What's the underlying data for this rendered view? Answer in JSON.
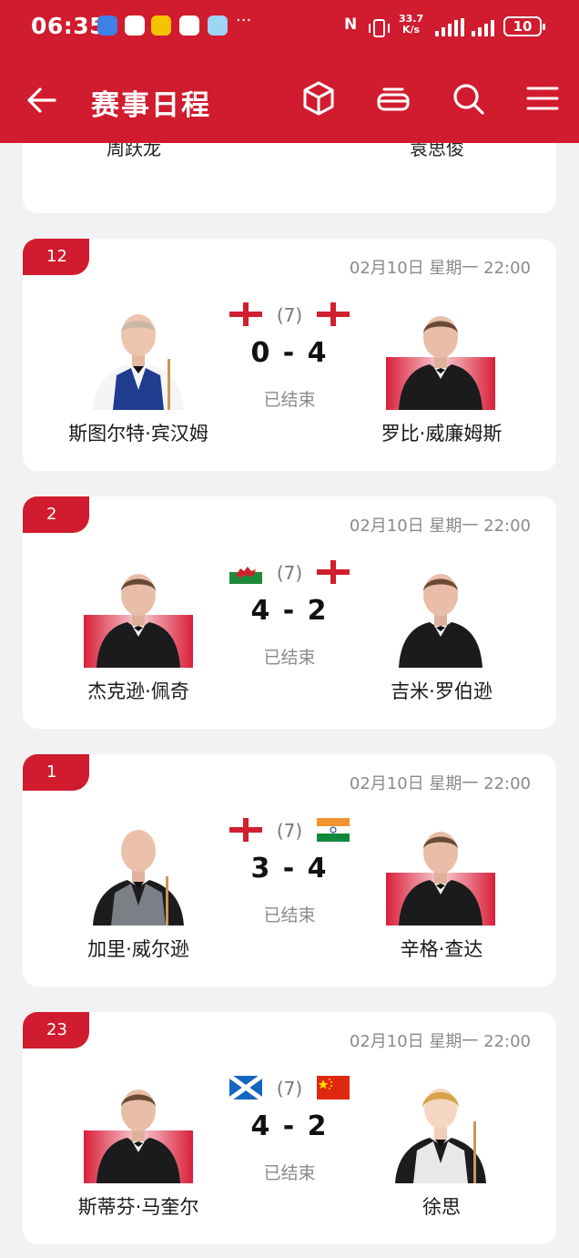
{
  "status_bar": {
    "time": "06:35",
    "more": "···",
    "network": "N",
    "speed_value": "33.7",
    "speed_unit": "K/s",
    "battery": "10"
  },
  "nav": {
    "title": "赛事日程"
  },
  "prev_match": {
    "player_left": "周跃龙",
    "player_right": "袁思俊"
  },
  "matches": [
    {
      "rank": "12",
      "date": "02月10日 星期一 22:00",
      "rounds": "(7)",
      "score": "0 - 4",
      "status": "已结束",
      "left": {
        "name": "斯图尔特·宾汉姆",
        "flag": "england"
      },
      "right": {
        "name": "罗比·威廉姆斯",
        "flag": "england"
      }
    },
    {
      "rank": "2",
      "date": "02月10日 星期一 22:00",
      "rounds": "(7)",
      "score": "4 - 2",
      "status": "已结束",
      "left": {
        "name": "杰克逊·佩奇",
        "flag": "wales"
      },
      "right": {
        "name": "吉米·罗伯逊",
        "flag": "england"
      }
    },
    {
      "rank": "1",
      "date": "02月10日 星期一 22:00",
      "rounds": "(7)",
      "score": "3 - 4",
      "status": "已结束",
      "left": {
        "name": "加里·威尔逊",
        "flag": "england"
      },
      "right": {
        "name": "辛格·查达",
        "flag": "india"
      }
    },
    {
      "rank": "23",
      "date": "02月10日 星期一 22:00",
      "rounds": "(7)",
      "score": "4 - 2",
      "status": "已结束",
      "left": {
        "name": "斯蒂芬·马奎尔",
        "flag": "scotland"
      },
      "right": {
        "name": "徐思",
        "flag": "china"
      }
    }
  ],
  "colors": {
    "brand_red": "#d01c2e",
    "background": "#f2f2f4"
  }
}
